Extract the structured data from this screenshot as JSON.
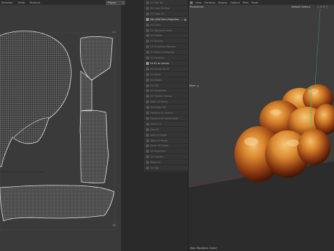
{
  "uv_editor": {
    "menu": [
      "Selection",
      "Fields",
      "Textures"
    ],
    "project_select": "Project",
    "corner_top_right": "1:1",
    "corner_bottom_right": "1|0"
  },
  "uv_panel": {
    "items": [
      {
        "label": "UV Edit Tex",
        "strong": false
      },
      {
        "label": "UV Cube 3D Map",
        "strong": false
      },
      {
        "label": "UV Cube 3D",
        "strong": false
      },
      {
        "label": "Set UVW From Projection",
        "strong": true,
        "active": true
      },
      {
        "label": "UV Cubic",
        "strong": false
      },
      {
        "label": "UV Spherical Lasso",
        "strong": false
      },
      {
        "label": "UV Flatten",
        "strong": false
      },
      {
        "label": "UV Packing",
        "strong": false
      },
      {
        "label": "UV Transform Packing",
        "strong": false
      },
      {
        "label": "UV Relax to Mapping",
        "strong": false
      },
      {
        "label": "UV Mapping",
        "strong": false
      },
      {
        "label": "Fit UV to Canvas",
        "strong": true
      },
      {
        "label": "Fit Canvas to UV",
        "strong": false
      },
      {
        "label": "UV Mirror",
        "strong": false
      },
      {
        "label": "UV Rotate",
        "strong": false
      },
      {
        "label": "UV Flip",
        "strong": false
      },
      {
        "label": "UV Straighten",
        "strong": false
      },
      {
        "label": "UV Tighten Islands",
        "strong": false
      },
      {
        "label": "Align UV Points",
        "strong": false
      },
      {
        "label": "Grid Align UV",
        "strong": false
      },
      {
        "label": "Equalize UV Islands",
        "strong": false
      },
      {
        "label": "Equalize UV Island Scale",
        "strong": false
      },
      {
        "label": "Select UV",
        "strong": false
      },
      {
        "label": "Sew UV",
        "strong": false
      },
      {
        "label": "Split UV Edges",
        "strong": false
      },
      {
        "label": "Weld UV Points",
        "strong": false
      },
      {
        "label": "Stitch UV Edges",
        "strong": false
      },
      {
        "label": "UV Distortion",
        "strong": false
      },
      {
        "label": "UV Checker",
        "strong": false
      },
      {
        "label": "Reset UV",
        "strong": false
      },
      {
        "label": "UV Info",
        "strong": false
      }
    ]
  },
  "viewport": {
    "menu": [
      "View",
      "Cameras",
      "Display",
      "Options",
      "Filter",
      "Panel"
    ],
    "camera_view": "Perspective",
    "default_camera": "Default Camera",
    "camera_icons": "○ ↕ ↻ □",
    "tool": "Move",
    "footer": "View Transform: Scene"
  },
  "colors": {
    "accent": "#5a8fd0",
    "bread_dark": "#6b2a10",
    "bread_light": "#e8a240"
  }
}
